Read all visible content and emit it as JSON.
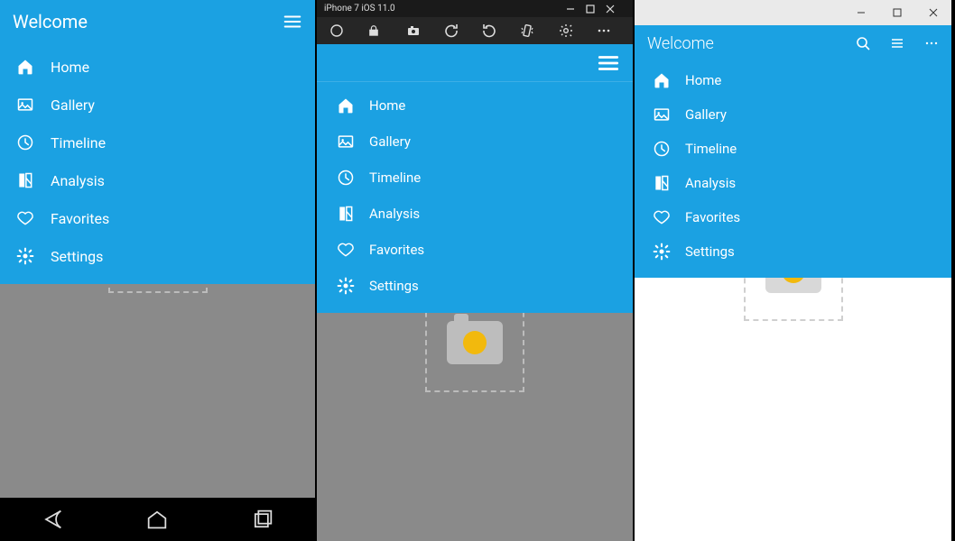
{
  "colors": {
    "accent": "#1ba1e2"
  },
  "menu": {
    "items": [
      {
        "icon": "home-icon",
        "label": "Home"
      },
      {
        "icon": "gallery-icon",
        "label": "Gallery"
      },
      {
        "icon": "timeline-icon",
        "label": "Timeline"
      },
      {
        "icon": "analysis-icon",
        "label": "Analysis"
      },
      {
        "icon": "favorites-icon",
        "label": "Favorites"
      },
      {
        "icon": "settings-icon",
        "label": "Settings"
      }
    ]
  },
  "android": {
    "title": "Welcome"
  },
  "ios": {
    "device_label": "iPhone 7 iOS 11.0"
  },
  "windows": {
    "title": "Welcome"
  }
}
